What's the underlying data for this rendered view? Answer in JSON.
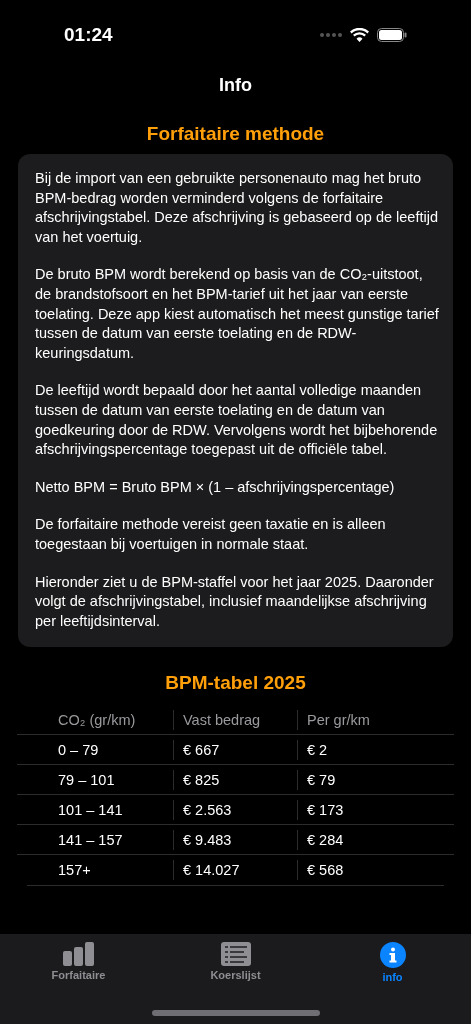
{
  "status_bar": {
    "time": "01:24"
  },
  "nav": {
    "title": "Info"
  },
  "sections": [
    {
      "heading": "Forfaitaire methode",
      "paragraphs": [
        "Bij de import van een gebruikte personenauto mag het bruto BPM-bedrag worden verminderd volgens de forfaitaire afschrijvingstabel. Deze afschrijving is gebaseerd op de leeftijd van het voertuig.",
        "De bruto BPM wordt berekend op basis van de CO₂-uitstoot, de brandstofsoort en het BPM-tarief uit het jaar van eerste toelating. Deze app kiest automatisch het meest gunstige tarief tussen de datum van eerste toelating en de RDW-keuringsdatum.",
        "De leeftijd wordt bepaald door het aantal volledige maanden tussen de datum van eerste toelating en de datum van goedkeuring door de RDW. Vervolgens wordt het bijbehorende afschrijvingspercentage toegepast uit de officiële tabel.",
        "Netto BPM = Bruto BPM × (1 – afschrijvingspercentage)",
        "De forfaitaire methode vereist geen taxatie en is alleen toegestaan bij voertuigen in normale staat.",
        "Hieronder ziet u de BPM-staffel voor het jaar 2025. Daaronder volgt de afschrijvingstabel, inclusief maandelijkse afschrijving per leeftijdsinterval."
      ]
    }
  ],
  "table": {
    "heading": "BPM-tabel 2025",
    "columns": [
      "CO₂ (gr/km)",
      "Vast bedrag",
      "Per gr/km"
    ],
    "rows": [
      [
        "0 – 79",
        "€ 667",
        "€ 2"
      ],
      [
        "79 – 101",
        "€ 825",
        "€ 79"
      ],
      [
        "101 – 141",
        "€ 2.563",
        "€ 173"
      ],
      [
        "141 – 157",
        "€ 9.483",
        "€ 284"
      ],
      [
        "157+",
        "€ 14.027",
        "€ 568"
      ]
    ]
  },
  "tab_bar": [
    {
      "label": "Forfaitaire",
      "kind": "chart",
      "selected": false
    },
    {
      "label": "Koerslijst",
      "kind": "list",
      "selected": false
    },
    {
      "label": "info",
      "kind": "info",
      "selected": true
    }
  ]
}
